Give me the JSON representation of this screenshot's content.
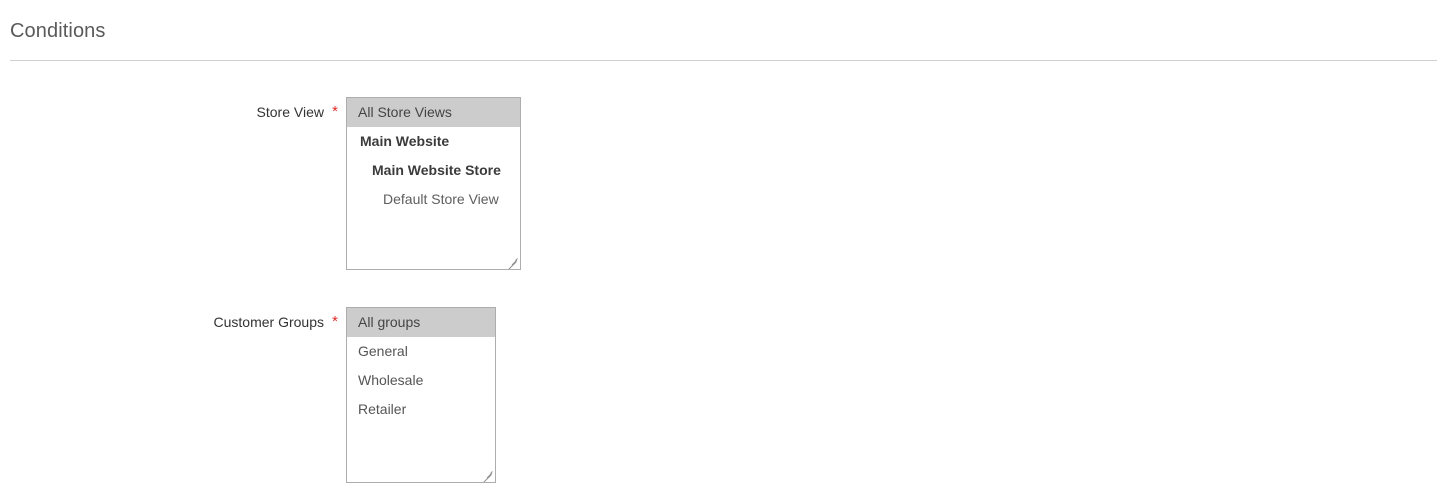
{
  "section": {
    "title": "Conditions"
  },
  "fields": {
    "store_view": {
      "label": "Store View",
      "required_mark": "*",
      "options": [
        {
          "label": "All Store Views",
          "level": 0,
          "selected": true
        },
        {
          "label": "Main Website",
          "level": 1,
          "selected": false
        },
        {
          "label": "Main Website Store",
          "level": 2,
          "selected": false
        },
        {
          "label": "Default Store View",
          "level": 3,
          "selected": false
        }
      ]
    },
    "customer_groups": {
      "label": "Customer Groups",
      "required_mark": "*",
      "options": [
        {
          "label": "All groups",
          "level": 0,
          "selected": true
        },
        {
          "label": "General",
          "level": 0,
          "selected": false
        },
        {
          "label": "Wholesale",
          "level": 0,
          "selected": false
        },
        {
          "label": "Retailer",
          "level": 0,
          "selected": false
        }
      ]
    }
  },
  "colors": {
    "required": "#e02b27",
    "selected_option_bg": "#cccccc",
    "border": "#adadad",
    "rule": "#d1d1d1",
    "heading": "#5a5a5a"
  }
}
